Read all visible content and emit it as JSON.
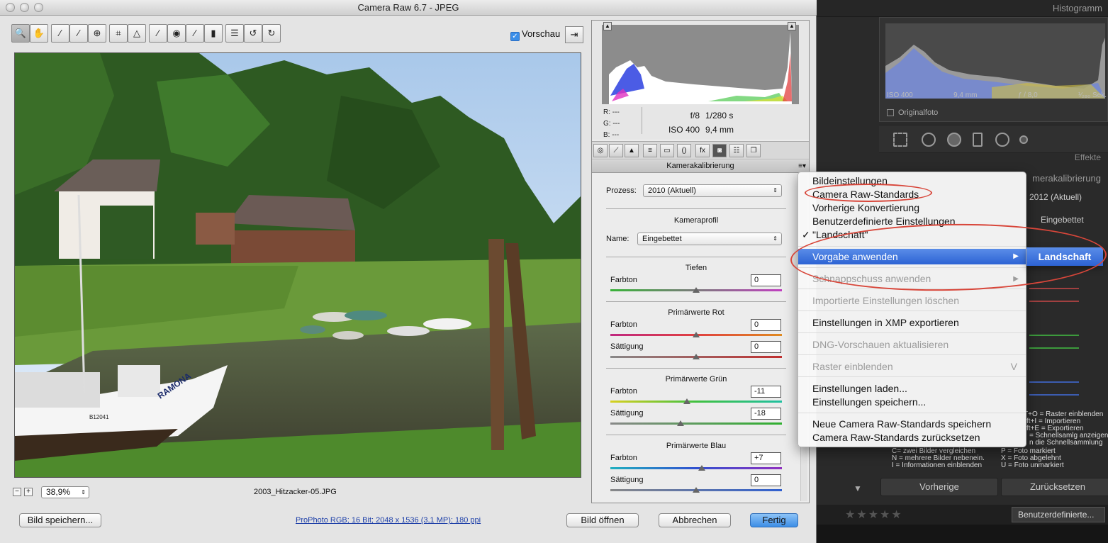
{
  "window": {
    "title": "Camera Raw 6.7 - JPEG"
  },
  "toolbar": {
    "tools": [
      "zoom-tool",
      "hand-tool",
      "white-balance-tool",
      "color-sampler-tool",
      "target-adjustment-tool",
      "crop-tool",
      "straighten-tool",
      "spot-removal-tool",
      "red-eye-tool",
      "adjustment-brush-tool",
      "graduated-filter-tool",
      "preferences-tool",
      "rotate-ccw-tool",
      "rotate-cw-tool"
    ],
    "preview_label": "Vorschau",
    "preview_checked": true
  },
  "photo": {
    "filename": "2003_Hitzacker-05.JPG",
    "zoom": "38,9%",
    "boat_name": "RAMONA",
    "boat_id": "B12041"
  },
  "histogram": {
    "rgb": {
      "r": "R:  ---",
      "g": "G:  ---",
      "b": "B:  ---"
    },
    "aperture": "f/8",
    "shutter": "1/280 s",
    "iso": "ISO 400",
    "focal": "9,4 mm"
  },
  "panel": {
    "section_title": "Kamerakalibrierung",
    "process_label": "Prozess:",
    "process_value": "2010 (Aktuell)",
    "profile_heading": "Kameraprofil",
    "name_label": "Name:",
    "name_value": "Eingebettet",
    "groups": {
      "tiefen": {
        "title": "Tiefen",
        "farbton_label": "Farbton",
        "farbton": "0"
      },
      "rot": {
        "title": "Primärwerte Rot",
        "farbton_label": "Farbton",
        "farbton": "0",
        "saettigung_label": "Sättigung",
        "saettigung": "0"
      },
      "gruen": {
        "title": "Primärwerte Grün",
        "farbton_label": "Farbton",
        "farbton": "-11",
        "saettigung_label": "Sättigung",
        "saettigung": "-18"
      },
      "blau": {
        "title": "Primärwerte Blau",
        "farbton_label": "Farbton",
        "farbton": "+7",
        "saettigung_label": "Sättigung",
        "saettigung": "0"
      }
    }
  },
  "footer": {
    "save_label": "Bild speichern...",
    "info": "ProPhoto RGB; 16 Bit; 2048 x 1536 (3,1 MP); 180 ppi",
    "open_label": "Bild öffnen",
    "cancel_label": "Abbrechen",
    "done_label": "Fertig"
  },
  "menu": {
    "items": {
      "bild": "Bildeinstellungen",
      "standards": "Camera Raw-Standards",
      "vorherige": "Vorherige Konvertierung",
      "benutzer": "Benutzerdefinierte Einstellungen",
      "landschaft": "\"Landschaft\"",
      "vorgabe": "Vorgabe anwenden",
      "schnappschuss": "Schnappschuss anwenden",
      "importierte": "Importierte Einstellungen löschen",
      "xmp": "Einstellungen in XMP exportieren",
      "dng": "DNG-Vorschauen aktualisieren",
      "raster": "Raster einblenden",
      "raster_key": "V",
      "laden": "Einstellungen laden...",
      "speichern": "Einstellungen speichern...",
      "neue": "Neue Camera Raw-Standards speichern",
      "zurueck": "Camera Raw-Standards zurücksetzen"
    },
    "checkmark": "✓",
    "submenu_item": "Landschaft"
  },
  "lightroom": {
    "histogram_title": "Histogramm",
    "meta": [
      "ISO 400",
      "9,4 mm",
      "ƒ / 8,0",
      "¹⁄₂₈₀ Sek."
    ],
    "original_label": "Originalfoto",
    "effekte": "Effekte",
    "kamerakalibrierung": "merakalibrierung",
    "process": "2012 (Aktuell)",
    "profile": "Eingebettet",
    "shortcuts": [
      "T+O = Raster einblenden",
      "ft+I = Importieren",
      "ft+E = Exportieren",
      "= Schnellsamlg anzeigen",
      "n die Schnellsammlung",
      "C= zwei Bilder vergleichen",
      "P = Foto markiert",
      "N = mehrere Bilder nebenein.",
      "X = Foto abgelehnt",
      "I = Informationen einblenden",
      "U = Foto unmarkiert"
    ],
    "prev_button": "Vorherige",
    "reset_button": "Zurücksetzen",
    "filter_label": "Benutzerdefinierte..."
  },
  "colors": {
    "accent": "#2d63d4",
    "annotation": "#d8463a"
  }
}
